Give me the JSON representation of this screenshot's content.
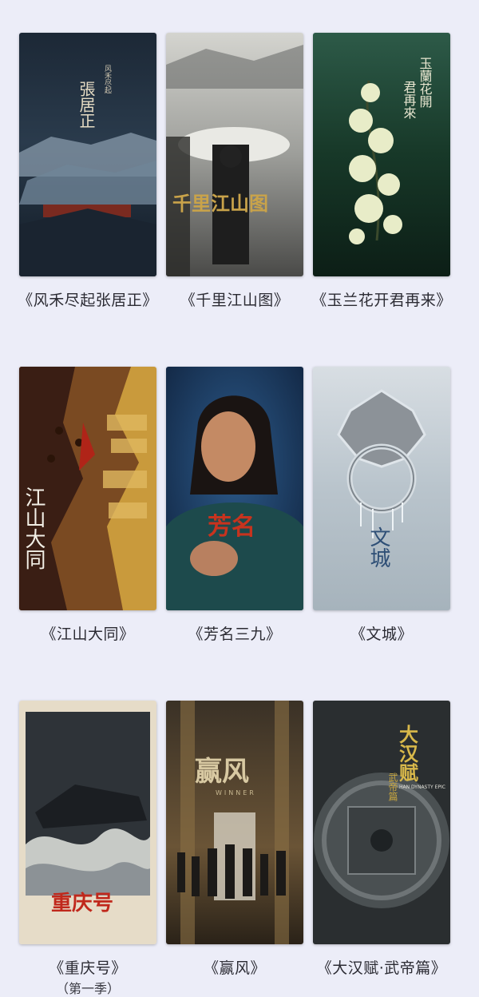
{
  "posters": [
    {
      "caption": "《风禾尽起张居正》",
      "art_text": [
        "張居正",
        "风禾尽起"
      ]
    },
    {
      "caption": "《千里江山图》",
      "art_text": [
        "千里江山图"
      ]
    },
    {
      "caption": "《玉兰花开君再来》",
      "art_text": [
        "玉蘭花開",
        "君再來"
      ]
    },
    {
      "caption": "《江山大同》",
      "art_text": [
        "江山大同"
      ]
    },
    {
      "caption": "《芳名三九》",
      "art_text": [
        "芳名"
      ]
    },
    {
      "caption": "《文城》",
      "art_text": [
        "文城"
      ]
    },
    {
      "caption": "《重庆号》",
      "subcaption": "（第一季）",
      "art_text": [
        "重庆号"
      ]
    },
    {
      "caption": "《赢风》",
      "art_text": [
        "赢风",
        "WINNER"
      ]
    },
    {
      "caption": "《大汉赋·武帝篇》",
      "art_text": [
        "大汉赋",
        "武帝篇",
        "HAN DYNASTY EPIC"
      ]
    }
  ],
  "colors": {
    "background": "#ecedf8",
    "caption": "#2b2b33"
  }
}
